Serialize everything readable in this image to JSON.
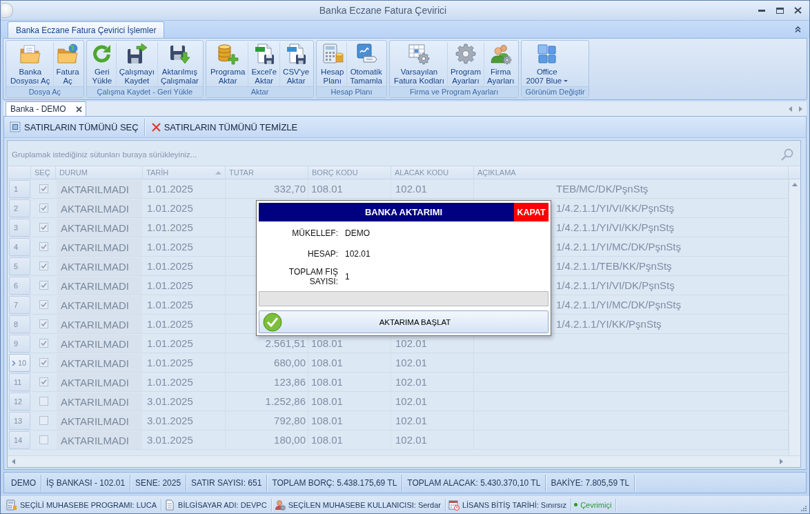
{
  "window": {
    "title": "Banka Eczane Fatura Çevirici"
  },
  "ribbon": {
    "tabs": [
      {
        "label": "Banka Eczane Fatura Çevirici İşlemler",
        "selected": true
      }
    ],
    "groups": [
      {
        "label": "Dosya Aç",
        "buttons": [
          {
            "kind": "large",
            "lines": [
              "Banka",
              "Dosyası Aç"
            ]
          },
          {
            "kind": "large",
            "lines": [
              "Fatura",
              "Aç"
            ]
          }
        ]
      },
      {
        "label": "Çalışma Kaydet - Geri Yükle",
        "buttons": [
          {
            "kind": "large",
            "lines": [
              "Geri",
              "Yükle"
            ]
          },
          {
            "kind": "large",
            "lines": [
              "Çalışmayı",
              "Kaydet"
            ]
          },
          {
            "kind": "large",
            "lines": [
              "Aktarılmış",
              "Çalışmalar"
            ]
          }
        ]
      },
      {
        "label": "Aktar",
        "buttons": [
          {
            "kind": "large",
            "lines": [
              "Programa",
              "Aktar"
            ]
          },
          {
            "kind": "large",
            "lines": [
              "Excel'e",
              "Aktar"
            ]
          },
          {
            "kind": "large",
            "lines": [
              "CSV'ye",
              "Aktar"
            ]
          }
        ]
      },
      {
        "label": "Hesap Planı",
        "buttons": [
          {
            "kind": "large",
            "lines": [
              "Hesap",
              "Planı"
            ]
          },
          {
            "kind": "large",
            "lines": [
              "Otomatik",
              "Tamamla"
            ]
          }
        ]
      },
      {
        "label": "Firma ve Program Ayarları",
        "buttons": [
          {
            "kind": "large",
            "lines": [
              "Varsayılan",
              "Fatura Kodları"
            ]
          },
          {
            "kind": "large",
            "lines": [
              "Program",
              "Ayarları"
            ]
          },
          {
            "kind": "large",
            "lines": [
              "Firma",
              "Ayarları"
            ]
          }
        ]
      },
      {
        "label": "Görünüm Değiştir",
        "buttons": [
          {
            "kind": "dropdown",
            "lines": [
              "Office",
              "2007 Blue"
            ]
          }
        ]
      }
    ]
  },
  "document_tabs": [
    {
      "label": "Banka - DEMO",
      "selected": true
    }
  ],
  "toolbar": [
    {
      "label": "SATIRLARIN TÜMÜNÜ SEÇ"
    },
    {
      "label": "SATIRLARIN TÜMÜNÜ TEMİZLE"
    }
  ],
  "grid": {
    "disabled": true,
    "group_panel_hint": "Gruplamak istediğiniz sütunları buraya sürükleyiniz...",
    "columns": [
      {
        "label": "SEÇ",
        "sorted": false
      },
      {
        "label": "DURUM",
        "sorted": false
      },
      {
        "label": "TARİH",
        "sorted": true
      },
      {
        "label": "TUTAR",
        "sorted": false
      },
      {
        "label": "BORÇ KODU",
        "sorted": false
      },
      {
        "label": "ALACAK KODU",
        "sorted": false
      },
      {
        "label": "AÇIKLAMA",
        "sorted": false
      }
    ],
    "rows": [
      {
        "number": "1",
        "selected": false,
        "checked": true,
        "status": "AKTARILMADI",
        "date": "1.01.2025",
        "amount": "332,70",
        "debit_code": "108.01",
        "credit_code": "102.01",
        "description": "TEB/MC/DK/PşnStş"
      },
      {
        "number": "2",
        "selected": false,
        "checked": true,
        "status": "AKTARILMADI",
        "date": "1.01.2025",
        "description": "1/4.2.1.1/YI/VI/KK/PşnStş"
      },
      {
        "number": "3",
        "selected": false,
        "checked": true,
        "status": "AKTARILMADI",
        "date": "1.01.2025",
        "description": "1/4.2.1.1/YI/VI/KK/PşnStş"
      },
      {
        "number": "4",
        "selected": false,
        "checked": true,
        "status": "AKTARILMADI",
        "date": "1.01.2025",
        "description": "1/4.2.1.1/YI/MC/DK/PşnStş"
      },
      {
        "number": "5",
        "selected": false,
        "checked": true,
        "status": "AKTARILMADI",
        "date": "1.01.2025",
        "description": "1/4.2.1.1/TEB/KK/PşnStş"
      },
      {
        "number": "6",
        "selected": false,
        "checked": true,
        "status": "AKTARILMADI",
        "date": "1.01.2025",
        "description": "1/4.2.1.1/YI/VI/DK/PşnStş"
      },
      {
        "number": "7",
        "selected": false,
        "checked": true,
        "status": "AKTARILMADI",
        "date": "1.01.2025",
        "description": "1/4.2.1.1/YI/MC/DK/PşnStş"
      },
      {
        "number": "8",
        "selected": false,
        "checked": true,
        "status": "AKTARILMADI",
        "date": "1.01.2025",
        "description": "1/4.2.1.1/YI/KK/PşnStş"
      },
      {
        "number": "9",
        "selected": false,
        "checked": true,
        "status": "AKTARILMADI",
        "date": "1.01.2025",
        "amount": "2.561,51",
        "debit_code": "108.01",
        "credit_code": "102.01"
      },
      {
        "number": "10",
        "selected": true,
        "checked": true,
        "status": "AKTARILMADI",
        "date": "1.01.2025",
        "amount": "680,00",
        "debit_code": "108.01",
        "credit_code": "102.01"
      },
      {
        "number": "11",
        "selected": false,
        "checked": true,
        "status": "AKTARILMADI",
        "date": "1.01.2025",
        "amount": "123,86",
        "debit_code": "108.01",
        "credit_code": "102.01"
      },
      {
        "number": "12",
        "selected": false,
        "checked": false,
        "status": "AKTARILMADI",
        "date": "3.01.2025",
        "amount": "1.252,86",
        "debit_code": "108.01",
        "credit_code": "102.01"
      },
      {
        "number": "13",
        "selected": false,
        "checked": false,
        "status": "AKTARILMADI",
        "date": "3.01.2025",
        "amount": "792,80",
        "debit_code": "108.01",
        "credit_code": "102.01"
      },
      {
        "number": "14",
        "selected": false,
        "checked": false,
        "status": "AKTARILMADI",
        "date": "3.01.2025",
        "amount": "180,00",
        "debit_code": "108.01",
        "credit_code": "102.01"
      }
    ]
  },
  "status_bar": [
    "DEMO",
    "İŞ BANKASI - 102.01",
    "SENE: 2025",
    "SATIR SAYISI: 651",
    "TOPLAM BORÇ: 5.438.175,69 TL",
    "TOPLAM ALACAK: 5.430.370,10 TL",
    "BAKİYE: 7.805,59 TL"
  ],
  "info_bar": [
    {
      "kind": "info",
      "label": "SEÇİLİ MUHASEBE PROGRAMI: LUCA"
    },
    {
      "kind": "info",
      "label": "BİLGİSAYAR ADI: DEVPC"
    },
    {
      "kind": "info",
      "label": "SEÇİLEN MUHASEBE KULLANICISI: Serdar"
    },
    {
      "kind": "info",
      "label": "LİSANS BİTİŞ TARİHİ: Sınırsız"
    },
    {
      "kind": "status",
      "label": "Çevrimiçi",
      "color": "#2a9a2a"
    }
  ],
  "dialog": {
    "title": "BANKA AKTARIMI",
    "close_label": "KAPAT",
    "fields": [
      {
        "label": "MÜKELLEF:",
        "value": "DEMO"
      },
      {
        "label": "HESAP:",
        "value": "102.01"
      },
      {
        "label": "TOPLAM FIŞ SAYISI:",
        "value": "1"
      }
    ],
    "progress": {
      "level": 0
    },
    "start_button": "AKTARIMA BAŞLAT"
  }
}
